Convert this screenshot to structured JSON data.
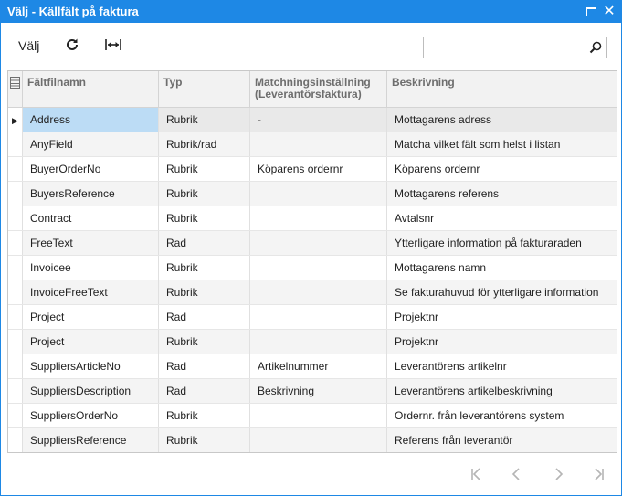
{
  "window": {
    "title": "Välj - Källfält på faktura",
    "maximize_icon": "maximize-icon",
    "close_glyph": "✕"
  },
  "toolbar": {
    "select_label": "Välj",
    "refresh_icon": "refresh-icon",
    "fit_columns_icon": "fit-columns-icon",
    "search_placeholder": "",
    "search_value": ""
  },
  "grid": {
    "columns": [
      "Fältfilnamn",
      "Typ",
      "Matchningsinställning (Leverantörsfaktura)",
      "Beskrivning"
    ],
    "rows": [
      {
        "name": "Address",
        "type": "Rubrik",
        "matching": "-",
        "description": "Mottagarens adress",
        "selected": true
      },
      {
        "name": "AnyField",
        "type": "Rubrik/rad",
        "matching": "",
        "description": "Matcha vilket fält som helst i listan"
      },
      {
        "name": "BuyerOrderNo",
        "type": "Rubrik",
        "matching": "Köparens ordernr",
        "description": "Köparens ordernr"
      },
      {
        "name": "BuyersReference",
        "type": "Rubrik",
        "matching": "",
        "description": "Mottagarens referens"
      },
      {
        "name": "Contract",
        "type": "Rubrik",
        "matching": "",
        "description": "Avtalsnr"
      },
      {
        "name": "FreeText",
        "type": "Rad",
        "matching": "",
        "description": "Ytterligare information på fakturaraden"
      },
      {
        "name": "Invoicee",
        "type": "Rubrik",
        "matching": "",
        "description": "Mottagarens namn"
      },
      {
        "name": "InvoiceFreeText",
        "type": "Rubrik",
        "matching": "",
        "description": "Se fakturahuvud för ytterligare information"
      },
      {
        "name": "Project",
        "type": "Rad",
        "matching": "",
        "description": "Projektnr"
      },
      {
        "name": "Project",
        "type": "Rubrik",
        "matching": "",
        "description": "Projektnr"
      },
      {
        "name": "SuppliersArticleNo",
        "type": "Rad",
        "matching": "Artikelnummer",
        "description": "Leverantörens artikelnr"
      },
      {
        "name": "SuppliersDescription",
        "type": "Rad",
        "matching": "Beskrivning",
        "description": "Leverantörens artikelbeskrivning"
      },
      {
        "name": "SuppliersOrderNo",
        "type": "Rubrik",
        "matching": "",
        "description": "Ordernr. från leverantörens system"
      },
      {
        "name": "SuppliersReference",
        "type": "Rubrik",
        "matching": "",
        "description": "Referens från leverantör"
      }
    ]
  },
  "pager": {
    "icons": [
      "first-page-icon",
      "previous-page-icon",
      "next-page-icon",
      "last-page-icon"
    ]
  },
  "colors": {
    "accent": "#1e88e5",
    "selected_cell": "#bcdcf5",
    "header_text": "#6e6e6e",
    "disabled_icon": "#b5b5b5"
  }
}
